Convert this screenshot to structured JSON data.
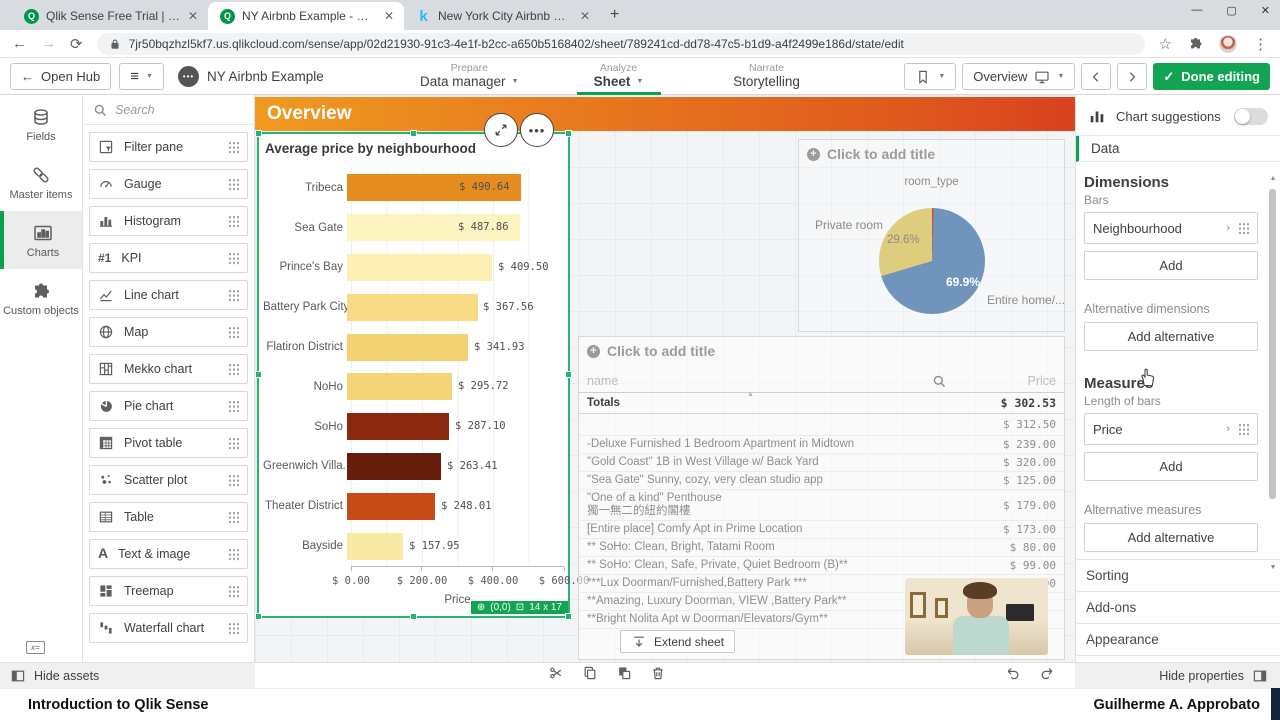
{
  "browser": {
    "tabs": [
      {
        "title": "Qlik Sense Free Trial | Qlik",
        "favicon": "qlik",
        "active": false
      },
      {
        "title": "NY Airbnb Example - Overview |",
        "favicon": "qlik",
        "active": true
      },
      {
        "title": "New York City Airbnb Open Data",
        "favicon": "kaggle",
        "active": false
      }
    ],
    "url": "7jr50bqzhzl5kf7.us.qlikcloud.com/sense/app/02d21930-91c3-4e1f-b2cc-a650b5168402/sheet/789241cd-dd78-47c5-b1d9-a4f2499e186d/state/edit"
  },
  "toolbar": {
    "open_hub": "Open Hub",
    "app_name": "NY Airbnb Example",
    "steps": [
      {
        "section": "Prepare",
        "item": "Data manager",
        "caret": true,
        "active": false
      },
      {
        "section": "Analyze",
        "item": "Sheet",
        "caret": true,
        "active": true
      },
      {
        "section": "Narrate",
        "item": "Storytelling",
        "caret": false,
        "active": false
      }
    ],
    "sheet_selector": "Overview",
    "done_editing": "Done editing"
  },
  "nav_rail": {
    "items": [
      {
        "label": "Fields",
        "icon": "database-icon",
        "active": false
      },
      {
        "label": "Master items",
        "icon": "link-icon",
        "active": false
      },
      {
        "label": "Charts",
        "icon": "bar-chart-icon",
        "active": true
      },
      {
        "label": "Custom objects",
        "icon": "puzzle-icon",
        "active": false
      }
    ]
  },
  "assets": {
    "search_placeholder": "Search",
    "items": [
      {
        "label": "Filter pane",
        "icon": "filter-pane"
      },
      {
        "label": "Gauge",
        "icon": "gauge"
      },
      {
        "label": "Histogram",
        "icon": "histogram"
      },
      {
        "label": "KPI",
        "icon": "kpi"
      },
      {
        "label": "Line chart",
        "icon": "line-chart"
      },
      {
        "label": "Map",
        "icon": "map"
      },
      {
        "label": "Mekko chart",
        "icon": "mekko"
      },
      {
        "label": "Pie chart",
        "icon": "pie"
      },
      {
        "label": "Pivot table",
        "icon": "pivot"
      },
      {
        "label": "Scatter plot",
        "icon": "scatter"
      },
      {
        "label": "Table",
        "icon": "table"
      },
      {
        "label": "Text & image",
        "icon": "text-image"
      },
      {
        "label": "Treemap",
        "icon": "treemap"
      },
      {
        "label": "Waterfall chart",
        "icon": "waterfall"
      }
    ]
  },
  "sheet": {
    "header_title": "Overview",
    "placeholder_title": "Click to add title",
    "position_badge": "(0,0)",
    "size_badge": "14 x 17",
    "extend_button": "Extend sheet"
  },
  "chart_data": [
    {
      "type": "bar",
      "title": "Average price by neighbourhood",
      "orientation": "horizontal",
      "categories": [
        "Tribeca",
        "Sea Gate",
        "Prince's Bay",
        "Battery Park City",
        "Flatiron District",
        "NoHo",
        "SoHo",
        "Greenwich Villa...",
        "Theater District",
        "Bayside"
      ],
      "values": [
        490.64,
        487.86,
        409.5,
        367.56,
        341.93,
        295.72,
        287.1,
        263.41,
        248.01,
        157.95
      ],
      "value_labels": [
        "$ 490.64",
        "$ 487.86",
        "$ 409.50",
        "$ 367.56",
        "$ 341.93",
        "$ 295.72",
        "$ 287.10",
        "$ 263.41",
        "$ 248.01",
        "$ 157.95"
      ],
      "colors": [
        "#e78c1e",
        "#fdf5c1",
        "#fcf0b5",
        "#f7db87",
        "#f3d272",
        "#f3d477",
        "#8c2a10",
        "#661d0b",
        "#c74b16",
        "#f8e9a4"
      ],
      "xlabel": "Price",
      "xlim": [
        0,
        600
      ],
      "xticks": [
        "$ 0.00",
        "$ 200.00",
        "$ 400.00",
        "$ 600.00"
      ]
    },
    {
      "type": "pie",
      "legend_title": "room_type",
      "slices": [
        {
          "label": "",
          "value": 0.5,
          "color": "#c0504d",
          "pct_label": ""
        },
        {
          "label": "Entire home/...",
          "value": 69.9,
          "color": "#7094bb",
          "pct_label": "69.9%"
        },
        {
          "label": "Private room",
          "value": 29.6,
          "color": "#ddcd7c",
          "pct_label": "29.6%"
        }
      ]
    },
    {
      "type": "table",
      "columns": [
        "name",
        "Price"
      ],
      "totals": {
        "label": "Totals",
        "value": "$ 302.53"
      },
      "rows": [
        {
          "name": "",
          "price": "$ 312.50"
        },
        {
          "name": "-Deluxe Furnished 1 Bedroom Apartment in Midtown",
          "price": "$ 239.00"
        },
        {
          "name": "\"Gold Coast\" 1B in West Village w/ Back Yard",
          "price": "$ 320.00"
        },
        {
          "name": "\"Sea Gate\" Sunny, cozy, very clean studio app",
          "price": "$ 125.00"
        },
        {
          "name": "\"One of a kind\" Penthouse",
          "name2": "獨一無二的紐約閣樓",
          "price": "$ 179.00"
        },
        {
          "name": "[Entire place] Comfy Apt in Prime Location",
          "price": "$ 173.00"
        },
        {
          "name": "** SoHo: Clean, Bright, Tatami Room",
          "price": "$ 80.00"
        },
        {
          "name": "** SoHo: Clean, Safe, Private, Quiet Bedroom (B)**",
          "price": "$ 99.00"
        },
        {
          "name": "***Lux Doorman/Furnished,Battery Park ***",
          "price": "$ 250.00"
        },
        {
          "name": "**Amazing, Luxury Doorman, VIEW ,Battery Park**",
          "price": ""
        },
        {
          "name": "**Bright Nolita Apt w Doorman/Elevators/Gym**",
          "price": ""
        }
      ]
    }
  ],
  "properties": {
    "chart_suggestions": "Chart suggestions",
    "toggle_on": false,
    "tab": "Data",
    "dimensions_title": "Dimensions",
    "dimensions_sub": "Bars",
    "dimension_value": "Neighbourhood",
    "add_label": "Add",
    "alt_dimensions_label": "Alternative dimensions",
    "add_alternative_label": "Add alternative",
    "measures_title": "Measures",
    "measures_sub": "Length of bars",
    "measure_value": "Price",
    "alt_measures_label": "Alternative measures",
    "sections": [
      "Sorting",
      "Add-ons",
      "Appearance"
    ]
  },
  "footer": {
    "hide_assets": "Hide assets",
    "hide_properties": "Hide properties"
  },
  "caption": {
    "left": "Introduction to Qlik Sense",
    "right": "Guilherme A. Approbato"
  },
  "colors": {
    "accent_green": "#12a452",
    "selection_green": "#23b573",
    "header_orange_start": "#f09a20",
    "header_orange_end": "#d9411f"
  }
}
